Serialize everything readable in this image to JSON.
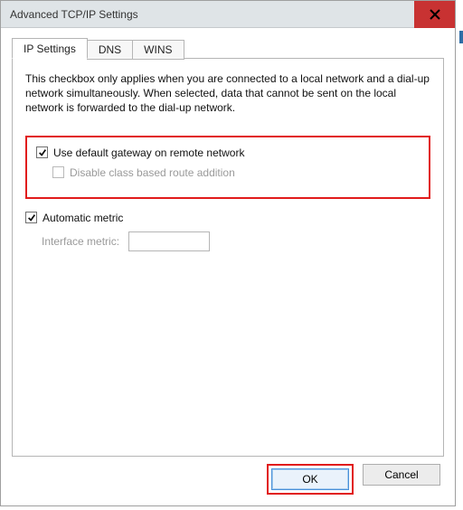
{
  "window": {
    "title": "Advanced TCP/IP Settings"
  },
  "tabs": {
    "ip": "IP Settings",
    "dns": "DNS",
    "wins": "WINS"
  },
  "panel": {
    "explain": "This checkbox only applies when you are connected to a local network and a dial-up network simultaneously. When selected, data that cannot be sent on the local network is forwarded to the dial-up network.",
    "use_default_gateway": "Use default gateway on remote network",
    "disable_class_route": "Disable class based route addition",
    "automatic_metric": "Automatic metric",
    "interface_metric_label": "Interface metric:",
    "interface_metric_value": ""
  },
  "buttons": {
    "ok": "OK",
    "cancel": "Cancel"
  },
  "state": {
    "use_default_gateway_checked": true,
    "disable_class_route_checked": false,
    "automatic_metric_checked": true
  },
  "colors": {
    "highlight": "#e11b1b",
    "close_bg": "#c83232"
  }
}
